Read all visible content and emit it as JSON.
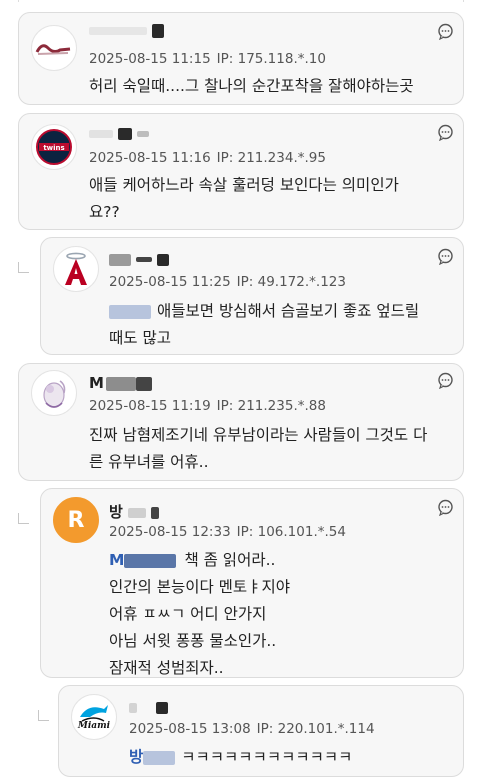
{
  "comments": [
    {
      "name": "",
      "datetime": "2025-08-15 11:15",
      "ip": "IP: 175.118.*.10",
      "text": "허리 숙일때....그 찰나의 순간포착을 잘해야하는곳"
    },
    {
      "name": "",
      "datetime": "2025-08-15 11:16",
      "ip": "IP: 211.234.*.95",
      "text_lines": [
        "애들 케어하느라 속살 훌러덩 보인다는 의미인가",
        "요??"
      ]
    },
    {
      "name": "",
      "datetime": "2025-08-15 11:25",
      "ip": "IP: 49.172.*.123",
      "text_lines": [
        "애들보면 방심해서 슴골보기 좋죠 엎드릴",
        "때도 많고"
      ]
    },
    {
      "name": "M",
      "datetime": "2025-08-15 11:19",
      "ip": "IP: 211.235.*.88",
      "text_lines": [
        "진짜 남혐제조기네 유부남이라는 사람들이 그것도 다",
        "른 유부녀를 어휴.."
      ]
    },
    {
      "name": "방",
      "avatar_letter": "R",
      "datetime": "2025-08-15 12:33",
      "ip": "IP: 106.101.*.54",
      "mention": "M",
      "text_lines": [
        "책 좀 읽어라..",
        "인간의 본능이다 멘토ㅑ지야",
        "어휴 ㅍㅆㄱ 어디 안가지",
        "아님 서윗 퐁퐁 물소인가..",
        "잠재적 성범죄자.."
      ]
    },
    {
      "name": "",
      "datetime": "2025-08-15 13:08",
      "ip": "IP: 220.101.*.114",
      "mention": "방",
      "text": "ㅋㅋㅋㅋㅋㅋㅋㅋㅋㅋㅋㅋ"
    }
  ],
  "icons": {
    "comment": "comment-bubble-icon",
    "reply": "reply-arrow-icon"
  },
  "colors": {
    "card_bg": "#f7f7f7",
    "border": "#dcdcdc",
    "mention": "#2f5fb3",
    "r_avatar": "#f39a2d"
  }
}
